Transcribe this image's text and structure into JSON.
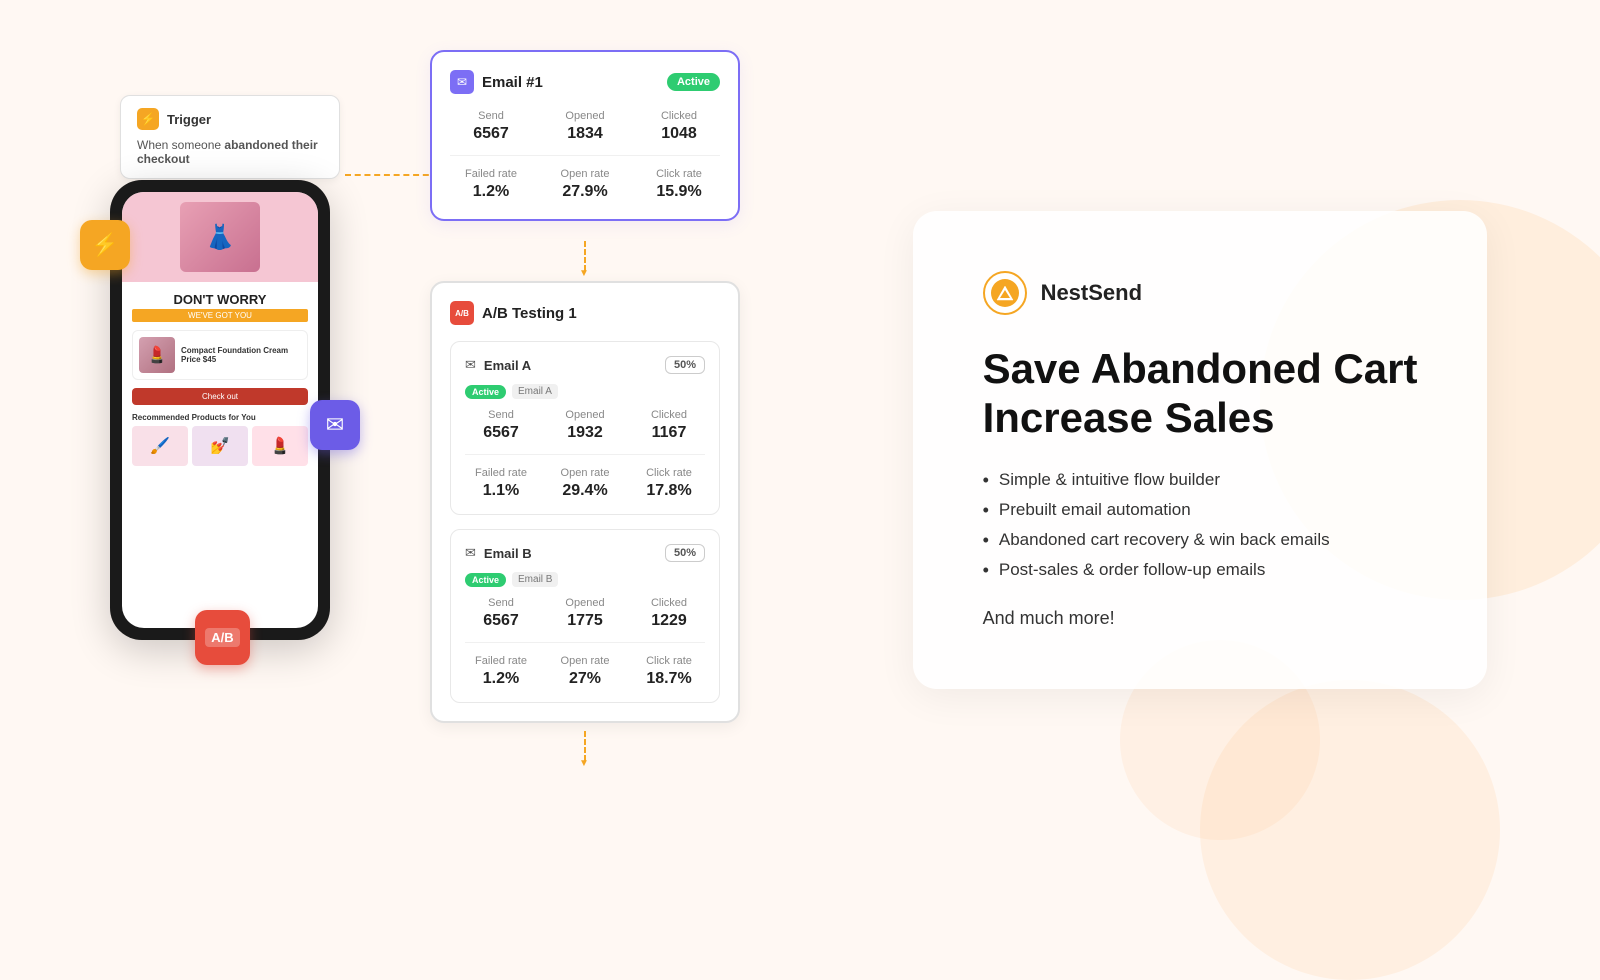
{
  "brand": {
    "name": "NestSend",
    "logo_icon": "▲"
  },
  "heading": {
    "line1": "Save Abandoned Cart",
    "line2": "Increase Sales"
  },
  "features": [
    "Simple & intuitive flow builder",
    "Prebuilt email automation",
    "Abandoned cart recovery & win back emails",
    "Post-sales & order follow-up emails"
  ],
  "more": "And much more!",
  "trigger": {
    "title": "Trigger",
    "description_prefix": "When someone ",
    "description_bold": "abandoned their checkout"
  },
  "email1": {
    "title": "Email #1",
    "badge": "Active",
    "stats": {
      "send_label": "Send",
      "send_value": "6567",
      "opened_label": "Opened",
      "opened_value": "1834",
      "clicked_label": "Clicked",
      "clicked_value": "1048",
      "failed_rate_label": "Failed rate",
      "failed_rate_value": "1.2%",
      "open_rate_label": "Open rate",
      "open_rate_value": "27.9%",
      "click_rate_label": "Click rate",
      "click_rate_value": "15.9%"
    }
  },
  "ab_test": {
    "title": "A/B Testing 1",
    "email_a": {
      "title": "Email A",
      "badge": "Active",
      "label": "Email A",
      "percentage": "50%",
      "stats": {
        "send_label": "Send",
        "send_value": "6567",
        "opened_label": "Opened",
        "opened_value": "1932",
        "clicked_label": "Clicked",
        "clicked_value": "1167",
        "failed_rate_label": "Failed rate",
        "failed_rate_value": "1.1%",
        "open_rate_label": "Open rate",
        "open_rate_value": "29.4%",
        "click_rate_label": "Click rate",
        "click_rate_value": "17.8%"
      }
    },
    "email_b": {
      "title": "Email B",
      "badge": "Active",
      "label": "Email B",
      "percentage": "50%",
      "stats": {
        "send_label": "Send",
        "send_value": "6567",
        "opened_label": "Opened",
        "opened_value": "1775",
        "clicked_label": "Clicked",
        "clicked_value": "1229",
        "failed_rate_label": "Failed rate",
        "failed_rate_value": "1.2%",
        "open_rate_label": "Open rate",
        "open_rate_value": "27%",
        "click_rate_label": "Click rate",
        "click_rate_value": "18.7%"
      }
    }
  },
  "phone": {
    "title": "DON'T WORRY",
    "subtitle": "WE'VE GOT YOU",
    "product_name": "Compact Foundation Cream",
    "product_price": "Price $45",
    "checkout_btn": "Check out",
    "recs_title": "Recommended Products for You"
  }
}
